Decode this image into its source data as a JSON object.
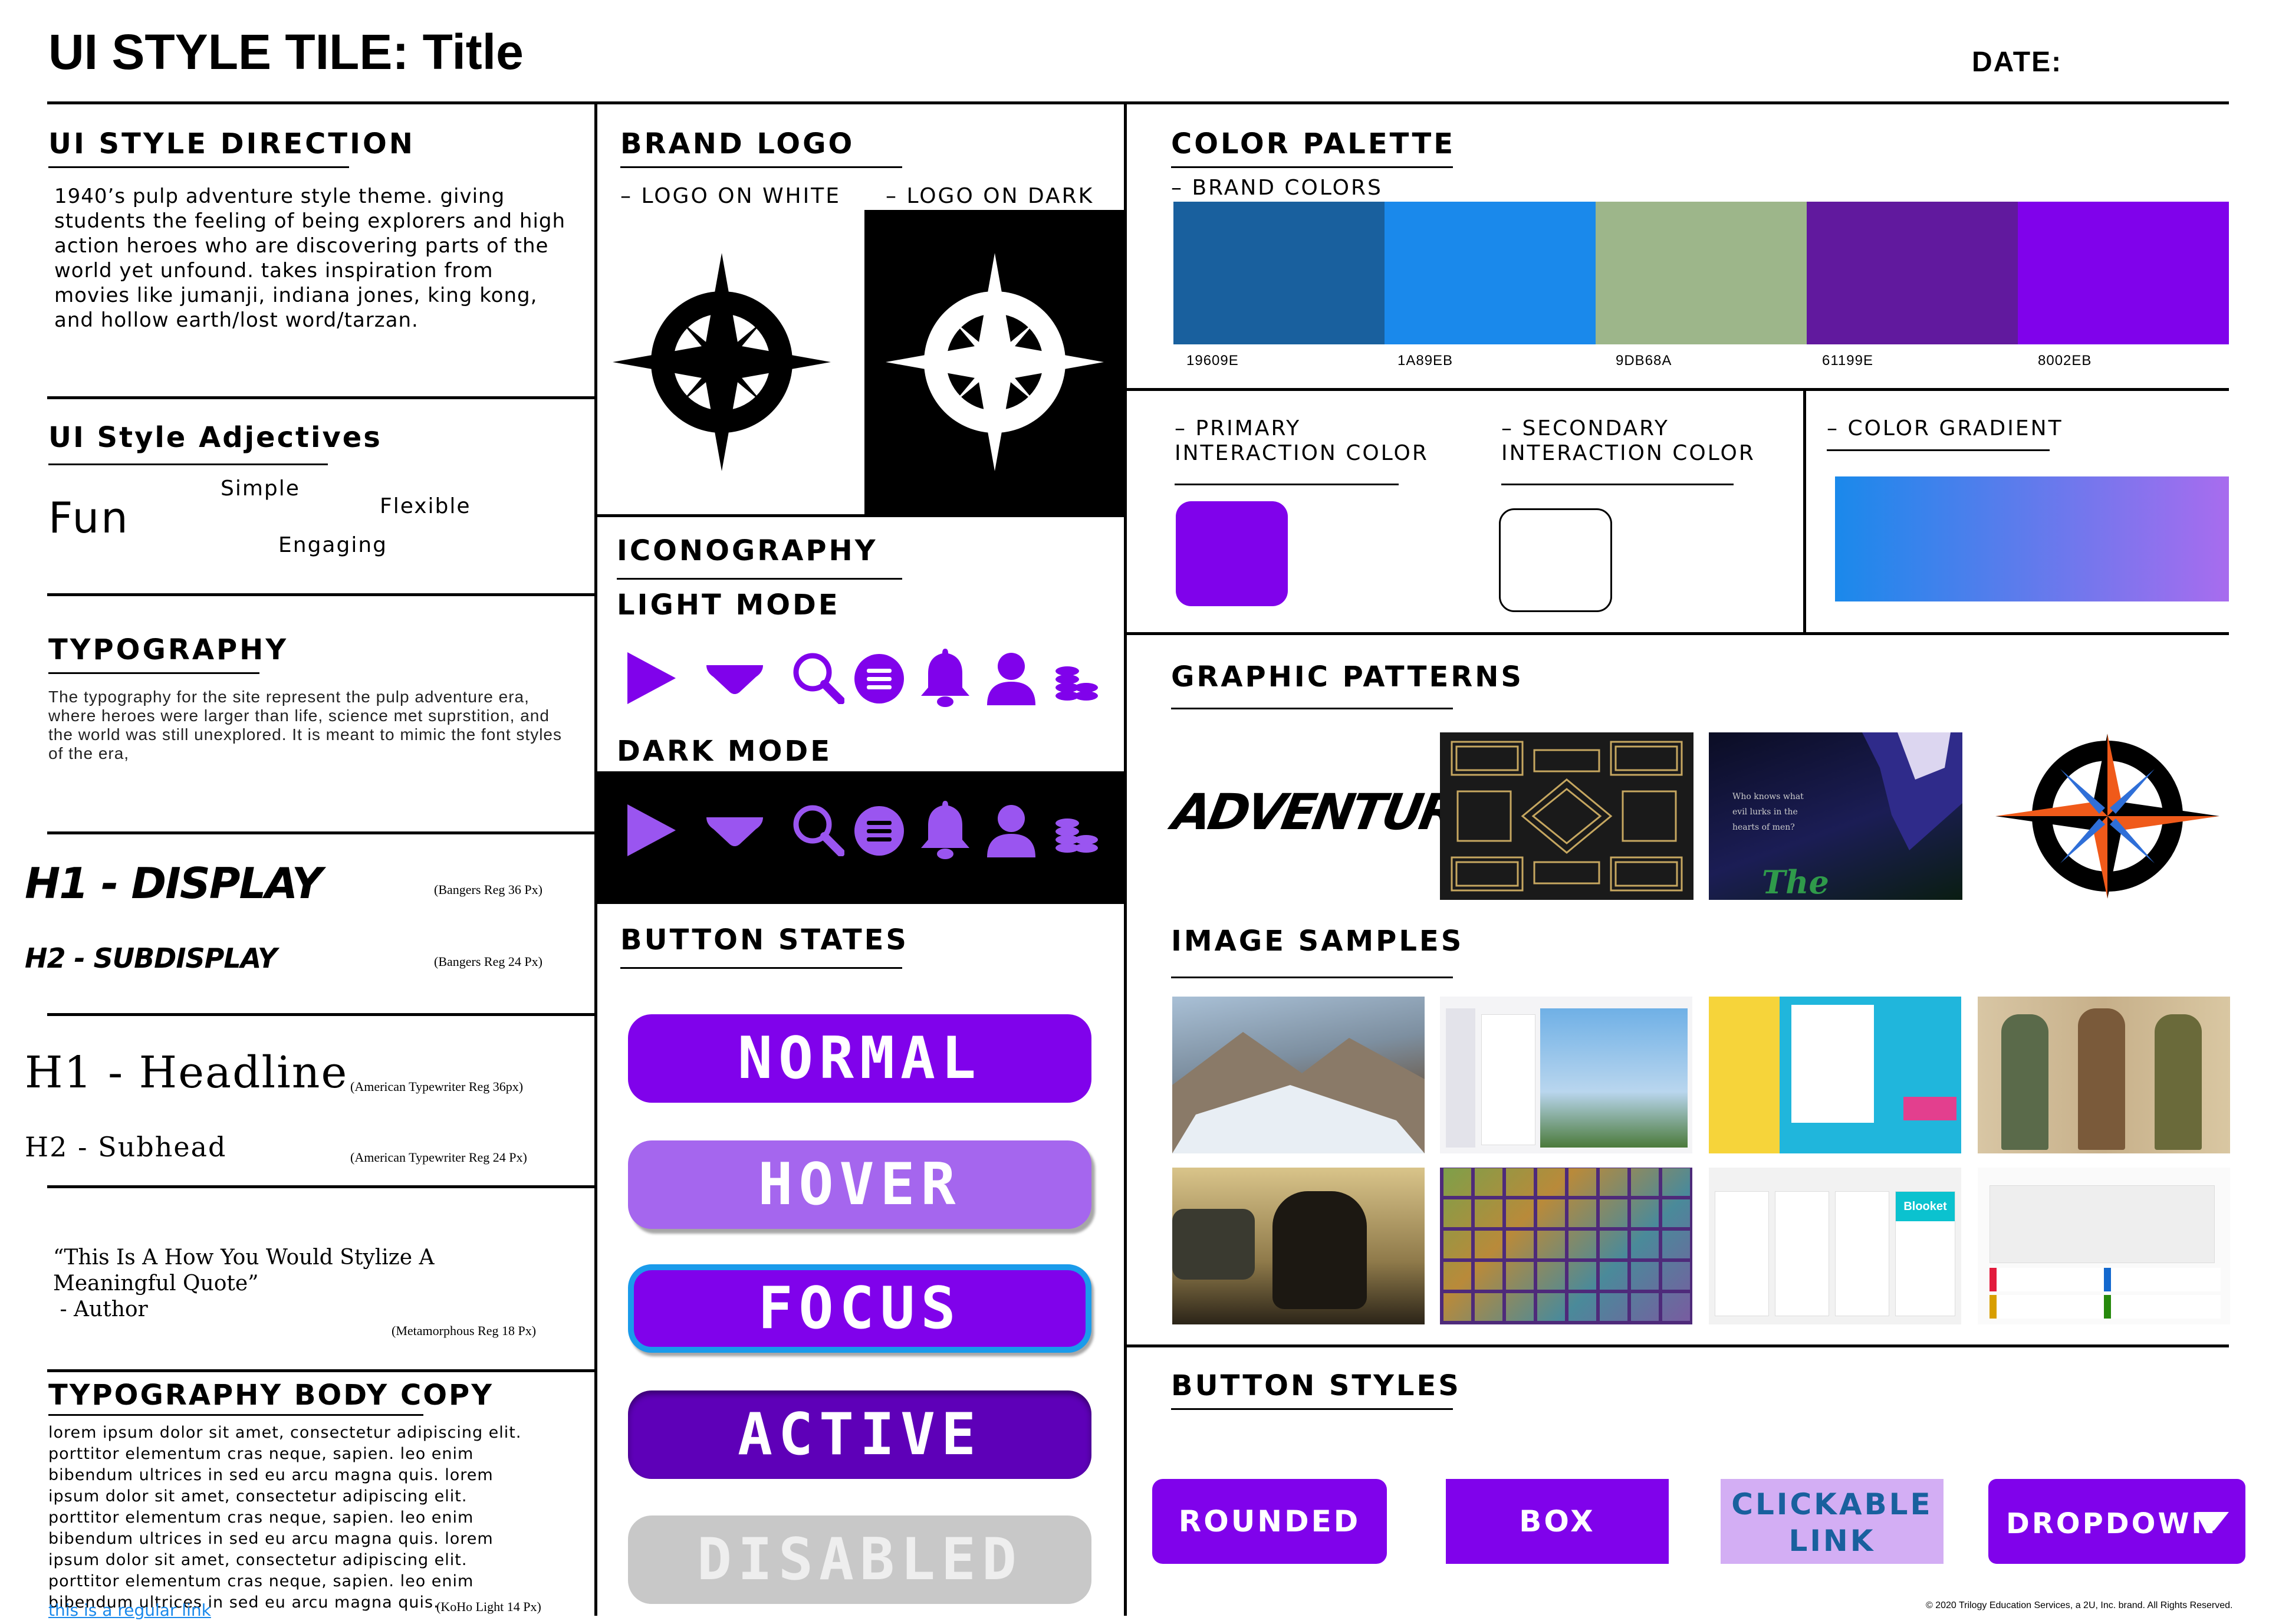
{
  "header": {
    "title": "UI STYLE TILE: Title",
    "date_label": "DATE:"
  },
  "direction": {
    "title": "UI STYLE DIRECTION",
    "text": "1940’s pulp adventure style theme. giving students the feeling of being explorers and high action heroes who are discovering parts of the world yet unfound. takes inspiration from movies like jumanji, indiana jones, king kong, and hollow earth/lost word/tarzan."
  },
  "adjectives": {
    "title": "UI Style Adjectives",
    "fun": "Fun",
    "simple": "Simple",
    "flexible": "Flexible",
    "engaging": "Engaging"
  },
  "typography": {
    "title": "TYPOGRAPHY",
    "text": "The typography for the site represent the pulp adventure era, where heroes were larger than life, science met suprstition, and the world was still unexplored. It is meant to mimic the font styles of the era,",
    "h1_display": "H1 - DISPLAY",
    "h1_display_note": "(Bangers Reg 36 Px)",
    "h2_subdisplay": "H2 - SUBDISPLAY",
    "h2_subdisplay_note": "(Bangers Reg 24 Px)",
    "h1_headline": "H1 - Headline",
    "h1_headline_note": "(American Typewriter Reg  36px)",
    "h2_subhead": "H2 - Subhead",
    "h2_subhead_note": "(American Typewriter Reg 24 Px)",
    "quote_line1": "“This Is A How You Would Stylize A",
    "quote_line2": "Meaningful Quote”",
    "quote_author": " - Author",
    "quote_note": "(Metamorphous Reg 18 Px)"
  },
  "body_copy": {
    "title": "TYPOGRAPHY BODY COPY",
    "text": "lorem ipsum dolor sit amet, consectetur adipiscing elit. porttitor elementum cras neque, sapien. leo enim bibendum ultrices in sed eu arcu magna quis. lorem ipsum dolor sit amet, consectetur adipiscing elit. porttitor elementum cras neque, sapien. leo enim bibendum ultrices in sed eu arcu magna quis. lorem ipsum dolor sit amet, consectetur adipiscing elit. porttitor elementum cras neque, sapien. leo enim bibendum ultrices in sed eu arcu magna quis.",
    "link": "this is a regular link",
    "note": "(KoHo Light 14 Px)"
  },
  "brand_logo": {
    "title": "BRAND LOGO",
    "on_white": "– LOGO ON WHITE",
    "on_dark": "– LOGO ON DARK"
  },
  "iconography": {
    "title": "ICONOGRAPHY",
    "light_mode": "LIGHT MODE",
    "dark_mode": "DARK MODE",
    "icons": [
      "play-icon",
      "caret-down-icon",
      "search-icon",
      "menu-icon",
      "bell-icon",
      "user-icon",
      "coins-icon"
    ]
  },
  "button_states": {
    "title": "BUTTON STATES",
    "normal": "NORMAL",
    "hover": "HOVER",
    "focus": "FOCUS",
    "active": "ACTIVE",
    "disabled": "DISABLED"
  },
  "palette": {
    "title": "COLOR PALETTE",
    "brand_colors": "– BRAND COLORS",
    "colors": [
      {
        "hex": "19609E",
        "color": "#19609E"
      },
      {
        "hex": "1A89EB",
        "color": "#1A89EB"
      },
      {
        "hex": "9DB68A",
        "color": "#9DB68A"
      },
      {
        "hex": "61199E",
        "color": "#61199E"
      },
      {
        "hex": "8002EB",
        "color": "#8002EB"
      }
    ],
    "primary_line1": "– PRIMARY",
    "primary_line2": "INTERACTION COLOR",
    "secondary_line1": "– SECONDARY",
    "secondary_line2": "INTERACTION COLOR",
    "gradient": "– COLOR GRADIENT"
  },
  "patterns": {
    "title": "GRAPHIC PATTERNS",
    "adventure": "ADVENTURE",
    "shadow_text": "Who knows what evil lurks in the hearts of men?",
    "shadow_title": "The Shadow"
  },
  "images": {
    "title": "IMAGE SAMPLES",
    "blooket": "Blooket"
  },
  "button_styles": {
    "title": "BUTTON STYLES",
    "rounded": "ROUNDED",
    "box": "BOX",
    "link_line1": "CLICKABLE",
    "link_line2": "LINK",
    "dropdown": "DROPDOWN"
  },
  "footer": {
    "copyright": "© 2020 Trilogy Education Services, a 2U, Inc. brand. All Rights Reserved."
  }
}
